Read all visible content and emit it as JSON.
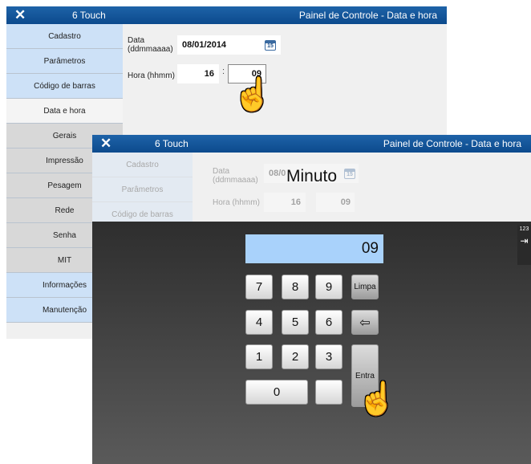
{
  "back_window": {
    "app_name": "6 Touch",
    "panel_title": "Painel de Controle - Data e hora",
    "sidebar": [
      {
        "label": "Cadastro",
        "style": "blue"
      },
      {
        "label": "Parâmetros",
        "style": "blue"
      },
      {
        "label": "Código de barras",
        "style": "blue"
      },
      {
        "label": "Data e hora",
        "style": "active"
      },
      {
        "label": "Gerais",
        "style": "gray"
      },
      {
        "label": "Impressão",
        "style": "gray"
      },
      {
        "label": "Pesagem",
        "style": "gray"
      },
      {
        "label": "Rede",
        "style": "gray"
      },
      {
        "label": "Senha",
        "style": "gray"
      },
      {
        "label": "MIT",
        "style": "gray"
      },
      {
        "label": "Informações",
        "style": "blue"
      },
      {
        "label": "Manutenção",
        "style": "blue"
      }
    ],
    "date_label": "Data\n(ddmmaaaa)",
    "date_value": "08/01/2014",
    "calendar_day": "15",
    "time_label": "Hora (hhmm)",
    "hour_value": "16",
    "minute_value": "09",
    "separator": ":"
  },
  "front_window": {
    "app_name": "6 Touch",
    "panel_title": "Painel de Controle - Data e hora",
    "faded": {
      "sidebar": [
        "Cadastro",
        "Parâmetros",
        "Código de barras"
      ],
      "date_label": "Data\n(ddmmaaaa)",
      "date_value": "08/0",
      "calendar_day": "15",
      "time_label": "Hora (hhmm)",
      "hour_value": "16",
      "minute_value": "09"
    },
    "popup_title": "Minuto",
    "display_value": "09",
    "keys": {
      "k7": "7",
      "k8": "8",
      "k9": "9",
      "clear": "Limpa",
      "k4": "4",
      "k5": "5",
      "k6": "6",
      "backspace": "⇦",
      "k1": "1",
      "k2": "2",
      "k3": "3",
      "enter": "Entra",
      "k0": "0"
    },
    "side_tab_label": "123",
    "side_tab_icon": "exit-icon"
  }
}
